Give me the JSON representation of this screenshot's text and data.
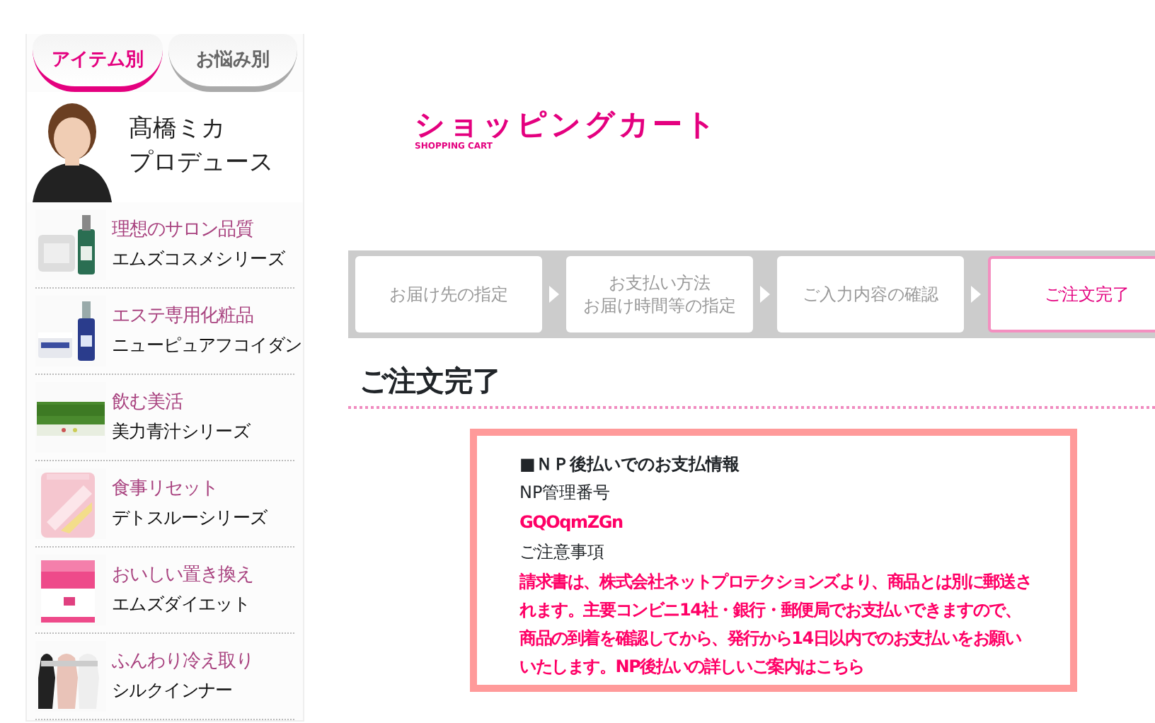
{
  "sidebar": {
    "tabs": [
      {
        "label": "アイテム別",
        "selected": true
      },
      {
        "label": "お悩み別",
        "selected": false
      }
    ],
    "banner": {
      "kind": "picture",
      "name": "髙橋ミカ",
      "caption": "プロデュース"
    },
    "items": [
      {
        "kind": "picture",
        "tagline": "理想のサロン品質",
        "name": "エムズコスメシリーズ"
      },
      {
        "kind": "picture",
        "tagline": "エステ専用化粧品",
        "name": "ニューピュアフコイダン"
      },
      {
        "kind": "picture",
        "tagline": "飲む美活",
        "name": "美力青汁シリーズ"
      },
      {
        "kind": "picture",
        "tagline": "食事リセット",
        "name": "デトスルーシリーズ"
      },
      {
        "kind": "picture",
        "tagline": "おいしい置き換え",
        "name": "エムズダイエット"
      },
      {
        "kind": "picture",
        "tagline": "ふんわり冷え取り",
        "name": "シルクインナー"
      }
    ]
  },
  "header": {
    "logo": "ショッピングカート",
    "logo_sub": "SHOPPING CART"
  },
  "steps": [
    {
      "lines": [
        "お届け先の指定"
      ],
      "selected": false
    },
    {
      "lines": [
        "お支払い方法",
        "お届け時間等の指定"
      ],
      "selected": false
    },
    {
      "lines": [
        "ご入力内容の確認"
      ],
      "selected": false
    },
    {
      "lines": [
        "ご注文完了"
      ],
      "selected": true
    }
  ],
  "title": "ご注文完了",
  "info": {
    "heading": "■ＮＰ後払いでのお支払情報",
    "rows": [
      {
        "kind": "label",
        "text": "NP管理番号"
      },
      {
        "kind": "value",
        "text": "GQOqmZGn"
      },
      {
        "kind": "label",
        "text": "ご注意事項"
      },
      {
        "kind": "value",
        "text": "請求書は、株式会社ネットプロテクションズより、商品とは別に郵送されます。主要コンビニ14社・銀行・郵便局でお支払いできますので、商品の到着を確認してから、発行から14日以内でのお支払いをお願いいたします。NP後払いの詳しいご案内はこちら"
      }
    ]
  }
}
